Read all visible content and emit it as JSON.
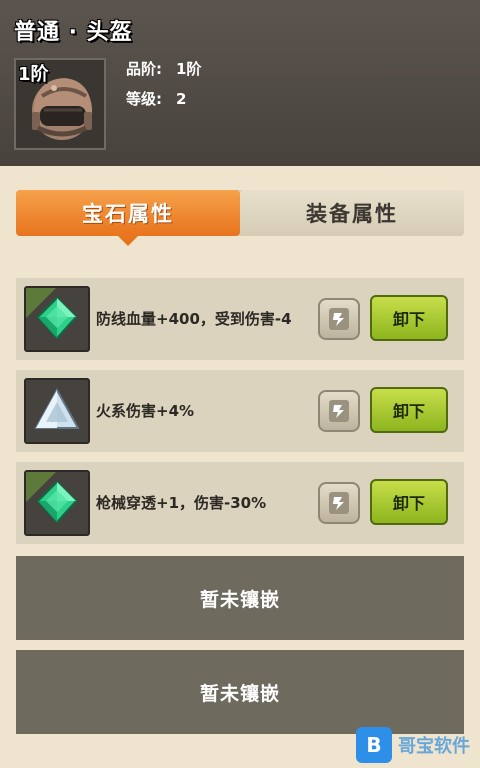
{
  "item": {
    "title": "普通 · 头盔",
    "tier_badge": "1阶",
    "icon": "helmet-icon",
    "grade_label": "品阶:",
    "grade_value": "1阶",
    "level_label": "等级:",
    "level_value": "2"
  },
  "tabs": [
    {
      "label": "宝石属性",
      "active": true
    },
    {
      "label": "装备属性",
      "active": false
    }
  ],
  "gems": [
    {
      "icon": "green-gem-icon",
      "text": "防线血量+400，受到伤害-4",
      "swap_icon": "swap-icon",
      "button": "卸下"
    },
    {
      "icon": "triangle-gem-icon",
      "text": "火系伤害+4%",
      "swap_icon": "swap-icon",
      "button": "卸下"
    },
    {
      "icon": "green-gem-icon",
      "text": "枪械穿透+1，伤害-30%",
      "swap_icon": "swap-icon",
      "button": "卸下"
    }
  ],
  "empty_slots": [
    {
      "label": "暂未镶嵌"
    },
    {
      "label": "暂未镶嵌"
    }
  ],
  "watermark": {
    "text": "哥宝软件"
  },
  "colors": {
    "active_tab": "#e8741e",
    "unload_button": "#a6c82e",
    "header_bg": "#4f4944",
    "page_bg": "#efe5cf"
  }
}
